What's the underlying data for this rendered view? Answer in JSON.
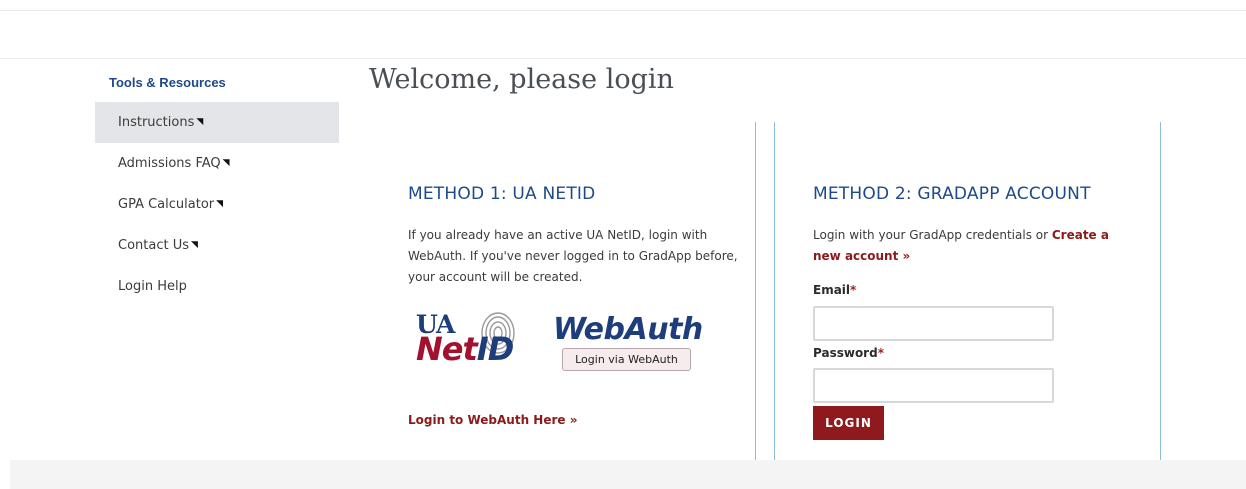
{
  "sidebar": {
    "heading": "Tools & Resources",
    "items": [
      {
        "label": "Instructions",
        "marker": "◥",
        "active": true
      },
      {
        "label": "Admissions FAQ",
        "marker": "◥",
        "active": false
      },
      {
        "label": "GPA Calculator",
        "marker": "◥",
        "active": false
      },
      {
        "label": "Contact Us",
        "marker": "◥",
        "active": false
      },
      {
        "label": "Login Help",
        "marker": "",
        "active": false
      }
    ]
  },
  "page": {
    "title": "Welcome, please login"
  },
  "method1": {
    "title": "METHOD 1: UA NETID",
    "description": "If you already have an active UA NetID, login with WebAuth. If you've never logged in to GradApp before, your account will be created.",
    "logo": {
      "ua": "UA",
      "net": "Net",
      "id": "ID",
      "webauth": "WebAuth"
    },
    "webauth_button": "Login via WebAuth",
    "webauth_link": "Login to WebAuth Here »"
  },
  "method2": {
    "title": "METHOD 2: GRADAPP ACCOUNT",
    "description_prefix": "Login with your GradApp credentials or ",
    "create_link": "Create a new account »",
    "email_label": "Email",
    "password_label": "Password",
    "required_marker": "*",
    "email_value": "",
    "password_value": "",
    "login_button": "LOGIN"
  },
  "colors": {
    "brand_blue": "#1e4a8a",
    "brand_red": "#8e1a1d",
    "panel_border": "#8fbcd9",
    "active_nav_bg": "#e3e5e8"
  }
}
